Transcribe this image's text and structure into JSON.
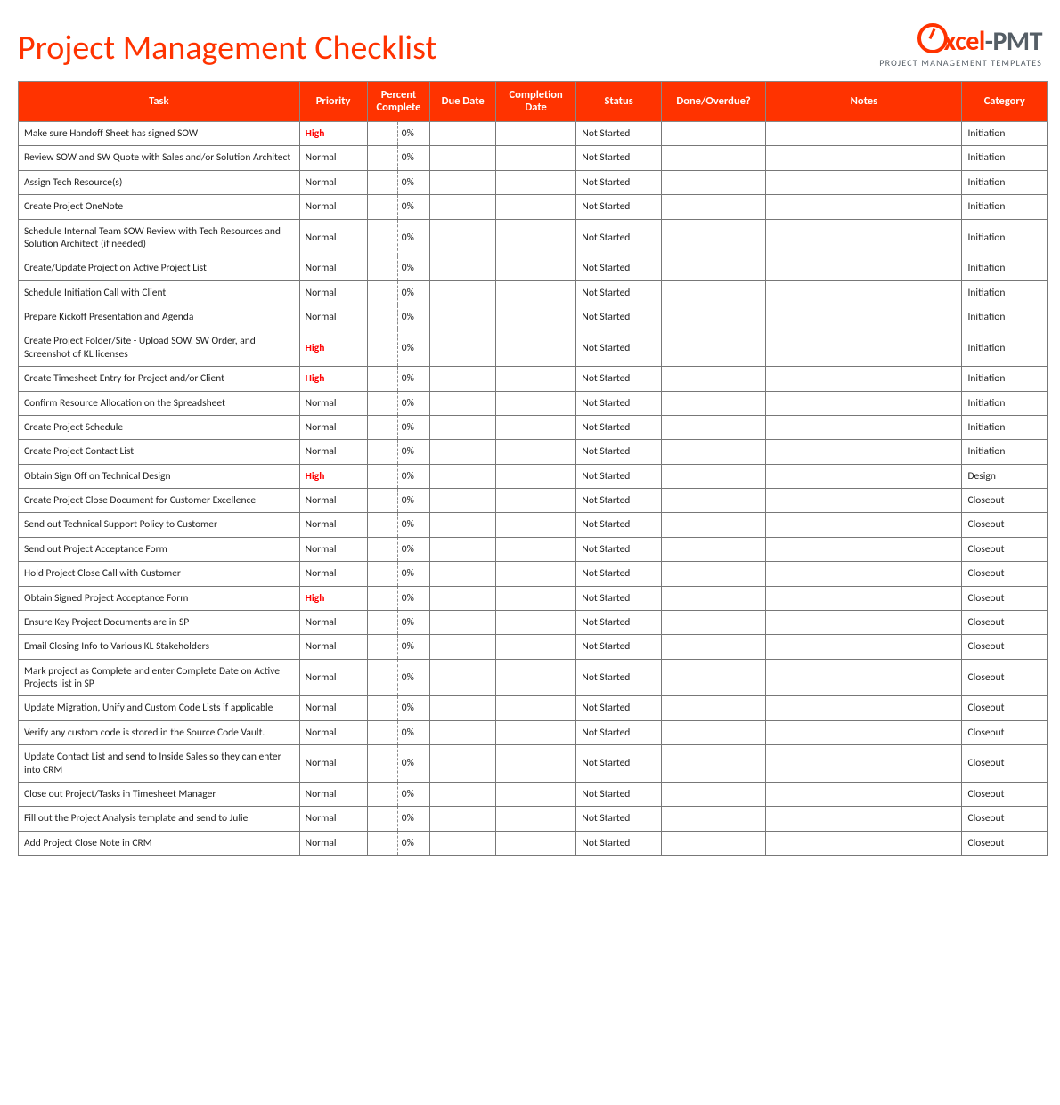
{
  "title": "Project Management Checklist",
  "brand": {
    "name_part1": "xcel",
    "name_part2": "-PMT",
    "subtitle": "PROJECT MANAGEMENT TEMPLATES"
  },
  "columns": [
    "Task",
    "Priority",
    "Percent Complete",
    "Due Date",
    "Completion Date",
    "Status",
    "Done/Overdue?",
    "Notes",
    "Category"
  ],
  "rows": [
    {
      "task": "Make sure Handoff Sheet has signed SOW",
      "priority": "High",
      "pct": "0%",
      "due": "",
      "comp": "",
      "status": "Not Started",
      "done": "",
      "notes": "",
      "cat": "Initiation"
    },
    {
      "task": "Review SOW and SW Quote with Sales and/or Solution Architect",
      "priority": "Normal",
      "pct": "0%",
      "due": "",
      "comp": "",
      "status": "Not Started",
      "done": "",
      "notes": "",
      "cat": "Initiation"
    },
    {
      "task": "Assign Tech Resource(s)",
      "priority": "Normal",
      "pct": "0%",
      "due": "",
      "comp": "",
      "status": "Not Started",
      "done": "",
      "notes": "",
      "cat": "Initiation"
    },
    {
      "task": "Create Project OneNote",
      "priority": "Normal",
      "pct": "0%",
      "due": "",
      "comp": "",
      "status": "Not Started",
      "done": "",
      "notes": "",
      "cat": "Initiation"
    },
    {
      "task": "Schedule Internal Team SOW Review with Tech Resources and Solution Architect (if needed)",
      "priority": "Normal",
      "pct": "0%",
      "due": "",
      "comp": "",
      "status": "Not Started",
      "done": "",
      "notes": "",
      "cat": "Initiation"
    },
    {
      "task": "Create/Update Project on Active Project List",
      "priority": "Normal",
      "pct": "0%",
      "due": "",
      "comp": "",
      "status": "Not Started",
      "done": "",
      "notes": "",
      "cat": "Initiation"
    },
    {
      "task": "Schedule Initiation Call with Client",
      "priority": "Normal",
      "pct": "0%",
      "due": "",
      "comp": "",
      "status": "Not Started",
      "done": "",
      "notes": "",
      "cat": "Initiation"
    },
    {
      "task": "Prepare Kickoff Presentation and Agenda",
      "priority": "Normal",
      "pct": "0%",
      "due": "",
      "comp": "",
      "status": "Not Started",
      "done": "",
      "notes": "",
      "cat": "Initiation"
    },
    {
      "task": "Create Project Folder/Site - Upload SOW, SW Order, and Screenshot of KL licenses",
      "priority": "High",
      "pct": "0%",
      "due": "",
      "comp": "",
      "status": "Not Started",
      "done": "",
      "notes": "",
      "cat": "Initiation"
    },
    {
      "task": "Create Timesheet Entry for Project and/or Client",
      "priority": "High",
      "pct": "0%",
      "due": "",
      "comp": "",
      "status": "Not Started",
      "done": "",
      "notes": "",
      "cat": "Initiation"
    },
    {
      "task": "Confirm Resource Allocation on the Spreadsheet",
      "priority": "Normal",
      "pct": "0%",
      "due": "",
      "comp": "",
      "status": "Not Started",
      "done": "",
      "notes": "",
      "cat": "Initiation"
    },
    {
      "task": "Create Project Schedule",
      "priority": "Normal",
      "pct": "0%",
      "due": "",
      "comp": "",
      "status": "Not Started",
      "done": "",
      "notes": "",
      "cat": "Initiation"
    },
    {
      "task": "Create Project Contact List",
      "priority": "Normal",
      "pct": "0%",
      "due": "",
      "comp": "",
      "status": "Not Started",
      "done": "",
      "notes": "",
      "cat": "Initiation"
    },
    {
      "task": "Obtain Sign Off on Technical Design",
      "priority": "High",
      "pct": "0%",
      "due": "",
      "comp": "",
      "status": "Not Started",
      "done": "",
      "notes": "",
      "cat": "Design"
    },
    {
      "task": "Create Project Close Document for Customer Excellence",
      "priority": "Normal",
      "pct": "0%",
      "due": "",
      "comp": "",
      "status": "Not Started",
      "done": "",
      "notes": "",
      "cat": "Closeout"
    },
    {
      "task": "Send out Technical Support Policy to Customer",
      "priority": "Normal",
      "pct": "0%",
      "due": "",
      "comp": "",
      "status": "Not Started",
      "done": "",
      "notes": "",
      "cat": "Closeout"
    },
    {
      "task": "Send out Project Acceptance Form",
      "priority": "Normal",
      "pct": "0%",
      "due": "",
      "comp": "",
      "status": "Not Started",
      "done": "",
      "notes": "",
      "cat": "Closeout"
    },
    {
      "task": "Hold Project Close Call with Customer",
      "priority": "Normal",
      "pct": "0%",
      "due": "",
      "comp": "",
      "status": "Not Started",
      "done": "",
      "notes": "",
      "cat": "Closeout"
    },
    {
      "task": "Obtain Signed Project Acceptance Form",
      "priority": "High",
      "pct": "0%",
      "due": "",
      "comp": "",
      "status": "Not Started",
      "done": "",
      "notes": "",
      "cat": "Closeout"
    },
    {
      "task": "Ensure Key Project Documents are in SP",
      "priority": "Normal",
      "pct": "0%",
      "due": "",
      "comp": "",
      "status": "Not Started",
      "done": "",
      "notes": "",
      "cat": "Closeout"
    },
    {
      "task": "Email Closing Info to Various KL Stakeholders",
      "priority": "Normal",
      "pct": "0%",
      "due": "",
      "comp": "",
      "status": "Not Started",
      "done": "",
      "notes": "",
      "cat": "Closeout"
    },
    {
      "task": "Mark project as Complete and enter Complete Date on Active Projects list in SP",
      "priority": "Normal",
      "pct": "0%",
      "due": "",
      "comp": "",
      "status": "Not Started",
      "done": "",
      "notes": "",
      "cat": "Closeout"
    },
    {
      "task": "Update Migration, Unify and Custom Code Lists if applicable",
      "priority": "Normal",
      "pct": "0%",
      "due": "",
      "comp": "",
      "status": "Not Started",
      "done": "",
      "notes": "",
      "cat": "Closeout"
    },
    {
      "task": "Verify any custom code is stored in the Source Code Vault.",
      "priority": "Normal",
      "pct": "0%",
      "due": "",
      "comp": "",
      "status": "Not Started",
      "done": "",
      "notes": "",
      "cat": "Closeout"
    },
    {
      "task": "Update Contact List and send to Inside Sales so they can enter into CRM",
      "priority": "Normal",
      "pct": "0%",
      "due": "",
      "comp": "",
      "status": "Not Started",
      "done": "",
      "notes": "",
      "cat": "Closeout"
    },
    {
      "task": "Close out Project/Tasks in Timesheet Manager",
      "priority": "Normal",
      "pct": "0%",
      "due": "",
      "comp": "",
      "status": "Not Started",
      "done": "",
      "notes": "",
      "cat": "Closeout"
    },
    {
      "task": "Fill out the Project Analysis template and send to Julie",
      "priority": "Normal",
      "pct": "0%",
      "due": "",
      "comp": "",
      "status": "Not Started",
      "done": "",
      "notes": "",
      "cat": "Closeout"
    },
    {
      "task": "Add Project Close Note in CRM",
      "priority": "Normal",
      "pct": "0%",
      "due": "",
      "comp": "",
      "status": "Not Started",
      "done": "",
      "notes": "",
      "cat": "Closeout"
    }
  ]
}
